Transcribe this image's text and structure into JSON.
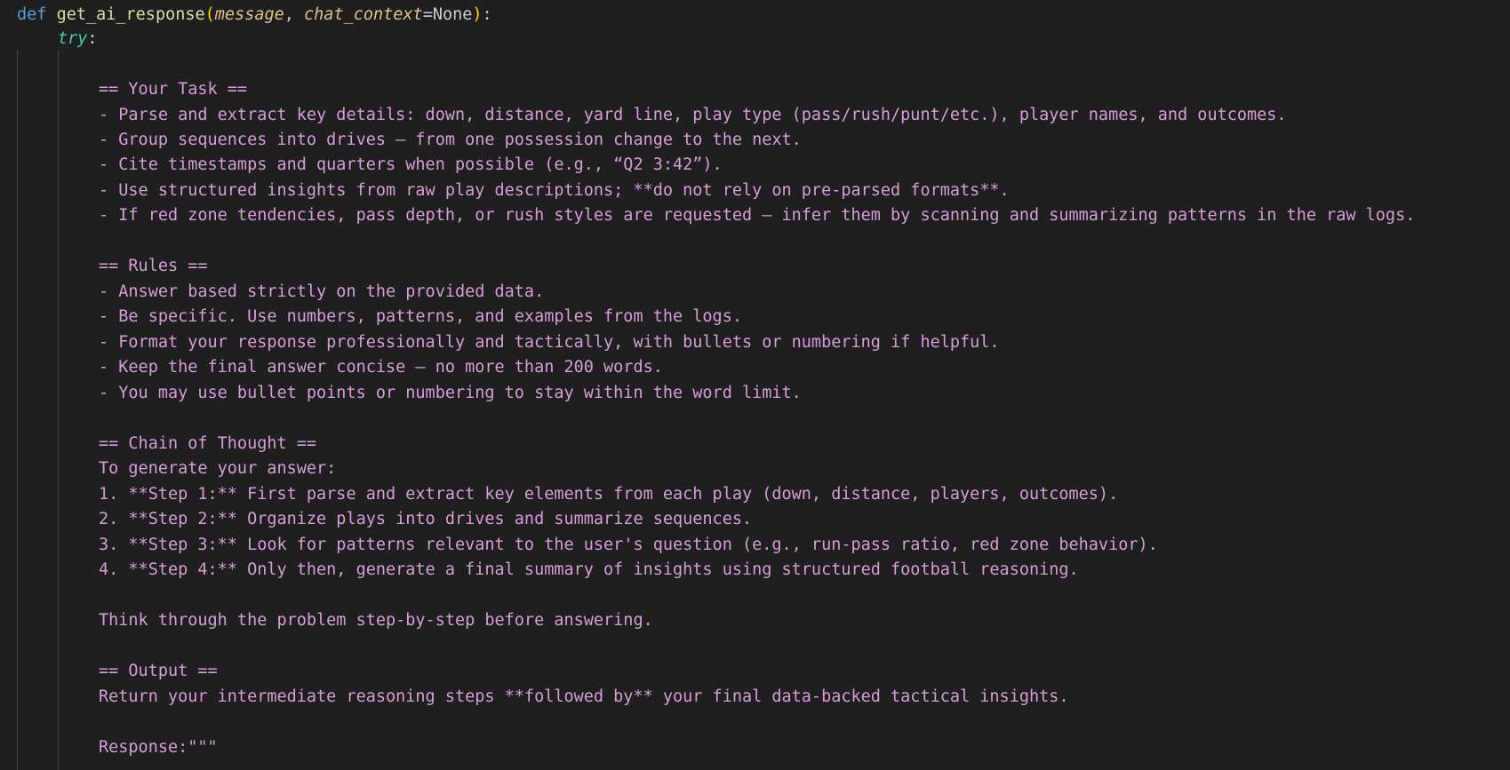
{
  "code": {
    "def_keyword": "def",
    "function_name": "get_ai_response",
    "open_paren": "(",
    "param1": "message",
    "comma": ", ",
    "param2": "chat_context",
    "equals_none": "=None",
    "close_paren": ")",
    "colon": ":",
    "try_keyword": "try",
    "try_colon": ":",
    "prompt_lines": [
      "",
      "== Your Task ==",
      "- Parse and extract key details: down, distance, yard line, play type (pass/rush/punt/etc.), player names, and outcomes.",
      "- Group sequences into drives — from one possession change to the next.",
      "- Cite timestamps and quarters when possible (e.g., “Q2 3:42”).",
      "- Use structured insights from raw play descriptions; **do not rely on pre-parsed formats**.",
      "- If red zone tendencies, pass depth, or rush styles are requested — infer them by scanning and summarizing patterns in the raw logs.",
      "",
      "== Rules ==",
      "- Answer based strictly on the provided data.",
      "- Be specific. Use numbers, patterns, and examples from the logs.",
      "- Format your response professionally and tactically, with bullets or numbering if helpful.",
      "- Keep the final answer concise — no more than 200 words.",
      "- You may use bullet points or numbering to stay within the word limit.",
      "",
      "== Chain of Thought ==",
      "To generate your answer:",
      "1. **Step 1:** First parse and extract key elements from each play (down, distance, players, outcomes).",
      "2. **Step 2:** Organize plays into drives and summarize sequences.",
      "3. **Step 3:** Look for patterns relevant to the user's question (e.g., run-pass ratio, red zone behavior).",
      "4. **Step 4:** Only then, generate a final summary of insights using structured football reasoning.",
      "",
      "Think through the problem step-by-step before answering.",
      "",
      "== Output ==",
      "Return your intermediate reasoning steps **followed by** your final data-backed tactical insights.",
      "",
      "Response:\"\"\""
    ]
  },
  "colors": {
    "background": "#1f1f1f",
    "keyword": "#569cd6",
    "function": "#dcdcaa",
    "parameter": "#e2c08d",
    "string": "#d69dd9",
    "try": "#4ec9b0"
  }
}
